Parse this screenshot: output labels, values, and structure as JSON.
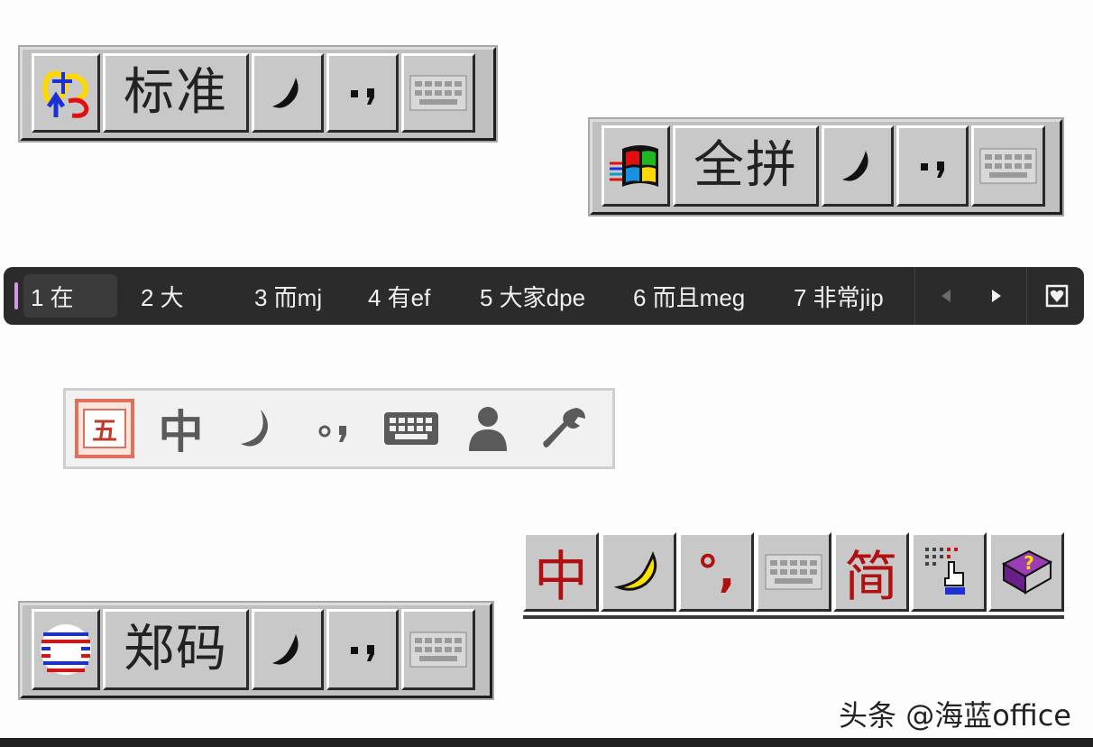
{
  "bars": [
    {
      "mode_label": "标准",
      "logo_icon": "mashing-logo-icon"
    },
    {
      "mode_label": "全拼",
      "logo_icon": "windows-flag-icon"
    },
    {
      "mode_label": "郑码",
      "logo_icon": "zhengma-logo-icon"
    }
  ],
  "candidates": {
    "items": [
      "1 在",
      "2 大",
      "3 而mj",
      "4 有ef",
      "5 大家dpe",
      "6 而且meg",
      "7 非常jip"
    ],
    "prev_icon": "triangle-left-icon",
    "next_icon": "triangle-right-icon",
    "emoji_icon": "heart-emoji-icon",
    "caret_color": "#d19ae6"
  },
  "modern_bar": {
    "wubi_label": "五",
    "lang_label": "中",
    "icons": [
      "moon-icon",
      "punctuation-icon",
      "keyboard-icon",
      "user-icon",
      "wrench-icon"
    ]
  },
  "right_bar": {
    "lang_label": "中",
    "punct_label": "°,",
    "simp_label": "简",
    "icons": [
      "banana-moon-icon",
      "keyboard-icon",
      "hand-pointer-icon",
      "help-book-icon"
    ]
  },
  "watermark": "头条 @海蓝office"
}
